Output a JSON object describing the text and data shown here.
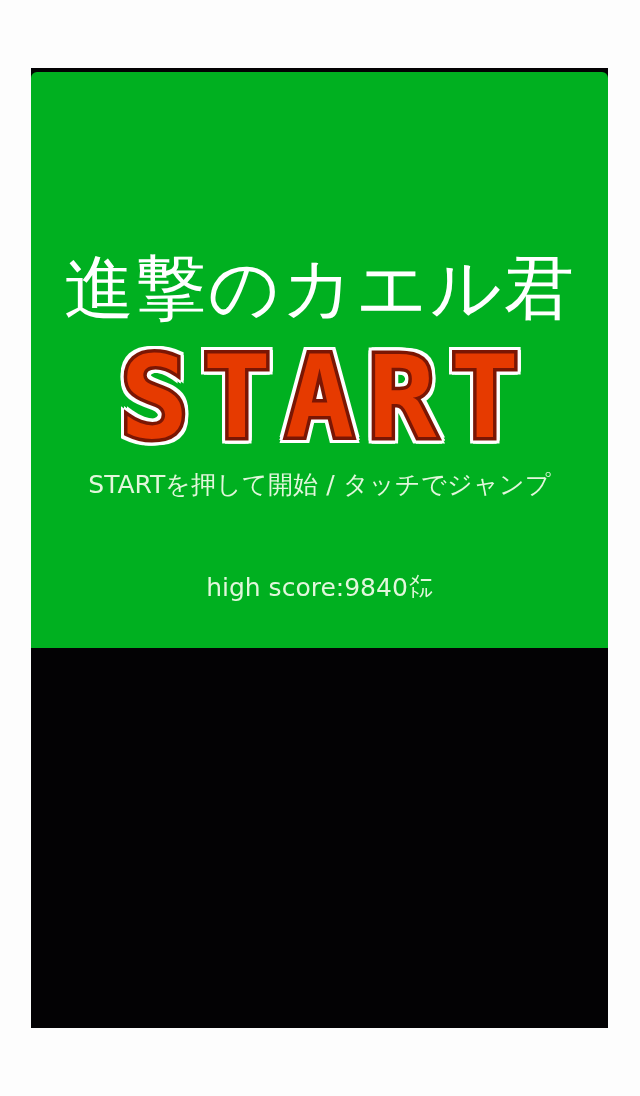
{
  "title": "進撃のカエル君",
  "start_button": {
    "label": "START"
  },
  "instructions": "STARTを押して開始 / タッチでジャンプ",
  "high_score": "high score:9840㍍"
}
